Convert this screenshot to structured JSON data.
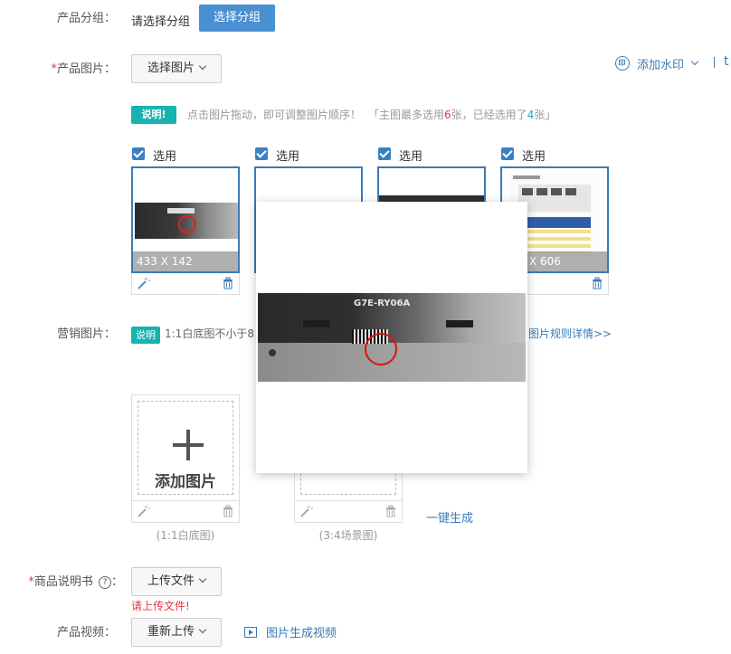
{
  "group": {
    "label": "产品分组：",
    "placeholder_text": "请选择分组",
    "button": "选择分组"
  },
  "images": {
    "label": "产品图片：",
    "select_button": "选择图片",
    "watermark": "添加水印",
    "watermark_badge": "印",
    "truncated_right": "t",
    "note_tag": "说明!",
    "note_text": "点击图片拖动，即可调整图片顺序！",
    "note_bracket_open": "「主图最多选用",
    "max_count": "6",
    "note_mid": "张，已经选用了",
    "used_count": "4",
    "note_end": "张」",
    "check_label": "选用",
    "dim_first": "433 X 142",
    "dim_last": "X 606"
  },
  "marketing": {
    "label": "营销图片：",
    "tag": "说明",
    "text": "1:1白底图不小于8",
    "rules_link": "图片规则详情>>",
    "add_image": "添加图片",
    "caption_1": "(1:1白底图)",
    "caption_2": "(3:4场景图)",
    "one_click": "一键生成"
  },
  "manual": {
    "label": "商品说明书",
    "button": "上传文件",
    "error": "请上传文件!"
  },
  "video": {
    "label": "产品视频：",
    "button": "重新上传",
    "link": "图片生成视频"
  },
  "popup": {
    "product_text": "G7E-RY06A"
  },
  "colors": {
    "accent": "#4a8fd1",
    "tag_green": "#17b3b0",
    "error": "#e4393c",
    "border_blue": "#3b7bb5"
  }
}
